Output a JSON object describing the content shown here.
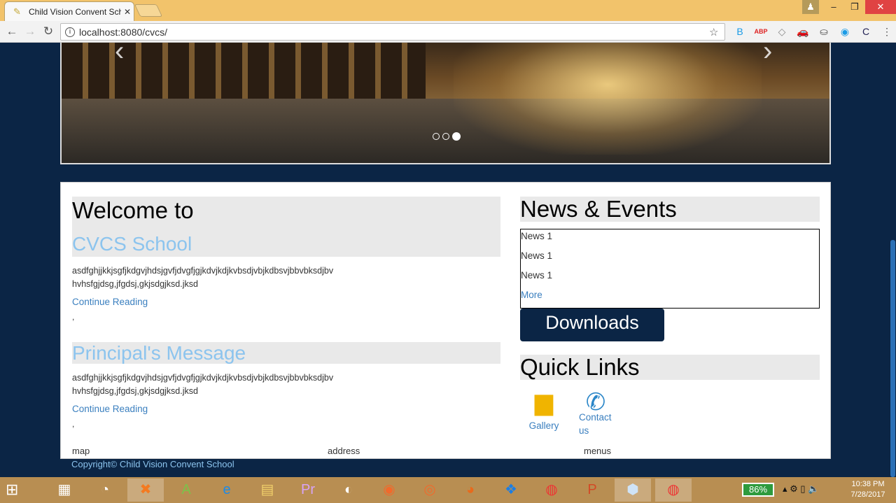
{
  "browser": {
    "tab_title": "Child Vision Convent Sch",
    "tab_close": "✕",
    "url": "localhost:8080/cvcs/",
    "window_controls": {
      "minimize": "–",
      "restore": "❐",
      "close": "✕"
    },
    "extensions": [
      "B",
      "ABP",
      "◇",
      "🚗",
      "⛀",
      "◉",
      "C",
      "⋮"
    ]
  },
  "carousel": {
    "prev": "‹",
    "next": "›",
    "slide_count": 3,
    "active_slide": 3
  },
  "welcome": {
    "heading": "Welcome to",
    "school": "CVCS School",
    "para_line1": "asdfghjjkkjsgfjkdgvjhdsjgvfjdvgfjgjkdvjkdjkvbsdjvbjkdbsvjbbvbksdjbv",
    "para_line2": "hvhsfgjdsg,jfgdsj,gkjsdgjksd.jksd",
    "link": "Continue Reading",
    "comma": ","
  },
  "principal": {
    "heading": "Principal's Message",
    "para_line1": "asdfghjjkkjsgfjkdgvjhdsjgvfjdvgfjgjkdvjkdjkvbsdjvbjkdbsvjbbvbksdjbv",
    "para_line2": "hvhsfgjdsg,jfgdsj,gkjsdgjksd.jksd",
    "link": "Continue Reading",
    "comma": ","
  },
  "news": {
    "heading": "News & Events",
    "items": [
      "News 1",
      "News 1",
      "News 1"
    ],
    "more": "More"
  },
  "downloads": {
    "label": "Downloads"
  },
  "quick_links": {
    "heading": "Quick Links",
    "gallery": "Gallery",
    "contact_line1": "Contact",
    "contact_line2": "us"
  },
  "footer": {
    "map": "map",
    "address": "address",
    "menus": "menus",
    "copyright": "Copyright© Child Vision Convent School"
  },
  "taskbar": {
    "battery": "86%",
    "time": "10:38 PM",
    "date": "7/28/2017"
  }
}
